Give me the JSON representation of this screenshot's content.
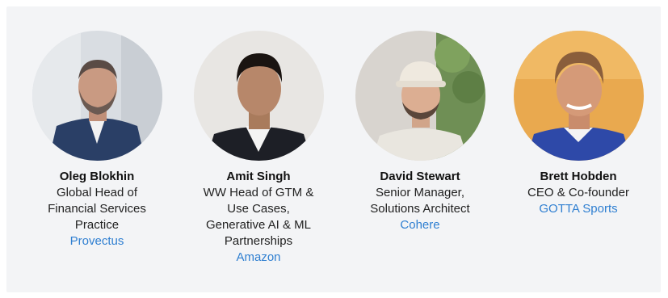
{
  "speakers": [
    {
      "name": "Oleg Blokhin",
      "title_lines": [
        "Global Head of",
        "Financial Services",
        "Practice"
      ],
      "company": "Provectus"
    },
    {
      "name": "Amit Singh",
      "title_lines": [
        "WW Head of GTM &",
        "Use Cases,",
        "Generative AI & ML",
        "Partnerships"
      ],
      "company": "Amazon"
    },
    {
      "name": "David Stewart",
      "title_lines": [
        "Senior Manager,",
        "Solutions Architect"
      ],
      "company": "Cohere"
    },
    {
      "name": "Brett Hobden",
      "title_lines": [
        "CEO & Co-founder"
      ],
      "company": "GOTTA Sports"
    }
  ],
  "colors": {
    "panel_bg": "#f3f4f6",
    "link": "#2f7fd1"
  }
}
